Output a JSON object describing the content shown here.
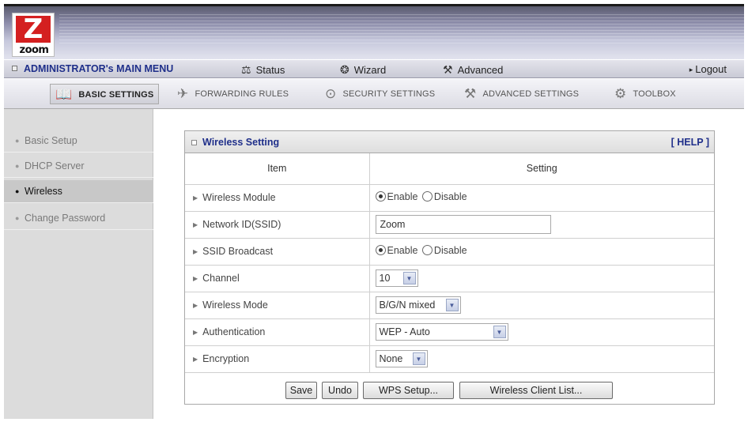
{
  "brand": {
    "logo_letter": "Z",
    "logo_text": "zoom"
  },
  "menu": {
    "main_title": "ADMINISTRATOR's MAIN MENU",
    "items": [
      {
        "label": "Status",
        "icon": "status-icon"
      },
      {
        "label": "Wizard",
        "icon": "wizard-icon"
      },
      {
        "label": "Advanced",
        "icon": "advanced-icon"
      }
    ],
    "logout_label": "Logout"
  },
  "tabs": [
    {
      "label": "BASIC SETTINGS",
      "icon": "basic-settings-icon",
      "active": true
    },
    {
      "label": "FORWARDING RULES",
      "icon": "forwarding-rules-icon",
      "active": false
    },
    {
      "label": "SECURITY SETTINGS",
      "icon": "security-settings-icon",
      "active": false
    },
    {
      "label": "ADVANCED SETTINGS",
      "icon": "advanced-settings-icon",
      "active": false
    },
    {
      "label": "TOOLBOX",
      "icon": "toolbox-icon",
      "active": false
    }
  ],
  "sidebar": {
    "items": [
      {
        "label": "Basic Setup",
        "active": false
      },
      {
        "label": "DHCP Server",
        "active": false
      },
      {
        "label": "Wireless",
        "active": true
      },
      {
        "label": "Change Password",
        "active": false
      }
    ]
  },
  "panel": {
    "title": "Wireless Setting",
    "help_label": "[ HELP ]",
    "col_item": "Item",
    "col_setting": "Setting",
    "rows": {
      "wireless_module": {
        "label": "Wireless Module",
        "enable_label": "Enable",
        "disable_label": "Disable",
        "selected": "Enable"
      },
      "ssid": {
        "label": "Network ID(SSID)",
        "value": "Zoom"
      },
      "ssid_broadcast": {
        "label": "SSID Broadcast",
        "enable_label": "Enable",
        "disable_label": "Disable",
        "selected": "Enable"
      },
      "channel": {
        "label": "Channel",
        "value": "10"
      },
      "wireless_mode": {
        "label": "Wireless Mode",
        "value": "B/G/N mixed"
      },
      "authentication": {
        "label": "Authentication",
        "value": "WEP - Auto"
      },
      "encryption": {
        "label": "Encryption",
        "value": "None"
      }
    },
    "buttons": {
      "save": "Save",
      "undo": "Undo",
      "wps": "WPS Setup...",
      "client_list": "Wireless Client List..."
    }
  },
  "colors": {
    "menu_title": "#1f2f8a",
    "logo_red": "#d42020",
    "sidebar_bg": "#dcdcdc",
    "sidebar_active_bg": "#c8c8c8"
  }
}
